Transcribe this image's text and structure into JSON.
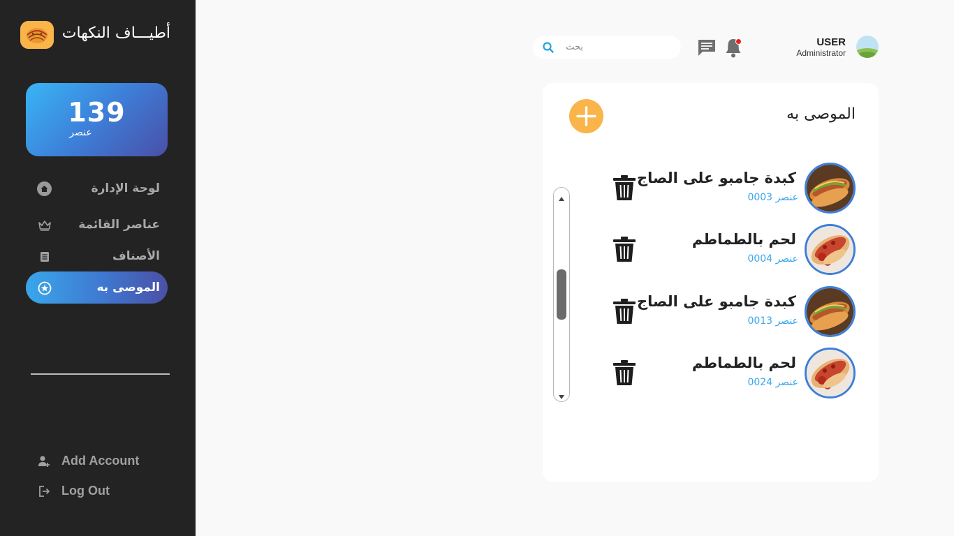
{
  "brand": {
    "name": "أطيـــاف النكهات",
    "logo_icon": "food-logo-icon"
  },
  "summary": {
    "count": "139",
    "label": "عنصر"
  },
  "nav": {
    "items": [
      {
        "label": "لوحة الإدارة",
        "icon": "home-icon"
      },
      {
        "label": "عناصر القائمة",
        "icon": "crown-icon"
      },
      {
        "label": "الأصناف",
        "icon": "document-icon"
      },
      {
        "label": "الموصى به",
        "icon": "star-icon",
        "active": true
      }
    ]
  },
  "account": {
    "add_label": "Add Account",
    "logout_label": "Log Out"
  },
  "search": {
    "placeholder": "بحث",
    "value": ""
  },
  "user": {
    "name": "USER",
    "role": "Administrator"
  },
  "notifications": {
    "has_unread": true
  },
  "main": {
    "title": "الموصى به",
    "items": [
      {
        "name": "كبدة جامبو على الصاج",
        "code": "عنصر 0003",
        "image": "hotdog-sandwich"
      },
      {
        "name": "لحم بالطماطم",
        "code": "عنصر 0004",
        "image": "meat-tomato-sandwich"
      },
      {
        "name": "كبدة جامبو على الصاج",
        "code": "عنصر 0013",
        "image": "hotdog-sandwich"
      },
      {
        "name": "لحم بالطماطم",
        "code": "عنصر 0024",
        "image": "meat-tomato-sandwich"
      }
    ]
  },
  "colors": {
    "sidebar_bg": "#232323",
    "accent_orange": "#f9b44a",
    "accent_blue": "#3aa6ea",
    "accent_indigo": "#4b4fa6",
    "page_bg": "#f9f9fa"
  }
}
